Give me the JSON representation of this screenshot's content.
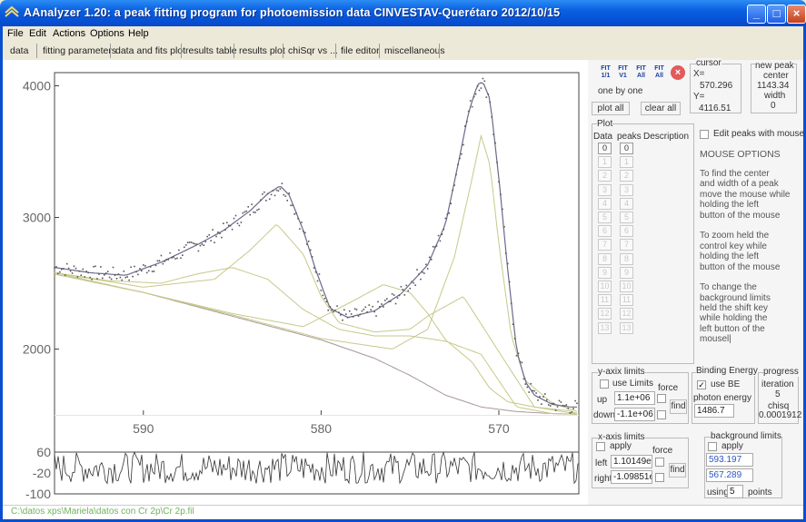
{
  "window": {
    "title": "AAnalyzer 1.20: a peak fitting program for photoemission data      CINVESTAV-Querétaro   2012/10/15",
    "close_icon": "×",
    "minimize_icon": "_",
    "maximize_icon": "□"
  },
  "menu": [
    "File",
    "Edit",
    "Actions",
    "Options",
    "Help"
  ],
  "tabs": [
    "data",
    "fitting parameters",
    "data and fits plot",
    "results table",
    "results plot",
    "chiSqr vs ...",
    "file editor",
    "miscellaneous"
  ],
  "toolbar": {
    "icons": [
      {
        "name": "fit-one-icon",
        "top": "FIT",
        "bottom": "1/1"
      },
      {
        "name": "fit-one-alt-icon",
        "top": "FIT",
        "bottom": "V1"
      },
      {
        "name": "fit-all-icon",
        "top": "FIT",
        "bottom": "All"
      },
      {
        "name": "fit-all-alt-icon",
        "top": "FIT",
        "bottom": "All"
      }
    ],
    "mode_label": "one by one",
    "plot_all": "plot all",
    "clear_all": "clear all"
  },
  "cursor": {
    "title": "cursor",
    "x_label": "X=",
    "x_value": "570.296",
    "y_label": "Y=",
    "y_value": "4116.51"
  },
  "new_peak": {
    "title": "new peak",
    "center_label": "center",
    "center_value": "1143.34",
    "width_label": "width",
    "width_value": "0"
  },
  "plot_panel": {
    "title": "Plot",
    "col_data": "Data",
    "col_peaks": "peaks",
    "col_desc": "Description",
    "data_items": [
      "0",
      "1",
      "2",
      "3",
      "4",
      "5",
      "6",
      "7",
      "8",
      "9",
      "10",
      "11",
      "12",
      "13"
    ],
    "peak_items": [
      "0",
      "1",
      "2",
      "3",
      "4",
      "5",
      "6",
      "7",
      "8",
      "9",
      "10",
      "11",
      "12",
      "13"
    ]
  },
  "edit_peaks": {
    "label": "Edit peaks with mouse"
  },
  "mouse_options": {
    "title": "MOUSE OPTIONS",
    "lines": [
      "To find the center",
      "and width of a peak",
      "move the mouse while",
      "holding the left",
      "button of the mouse",
      "",
      "To zoom held the",
      "control key while",
      "holding the left",
      "button of the mouse",
      "",
      "To change the",
      "background limits",
      "held the shift key",
      "while holding the",
      "left button of the",
      "mousel|"
    ]
  },
  "y_axis_limits": {
    "title": "y-axix limits",
    "use_limits": "use Limits",
    "force": "force",
    "up_label": "up",
    "up_value": "1.1e+06",
    "down_label": "down",
    "down_value": "-1.1e+06",
    "find": "find"
  },
  "binding_energy": {
    "title": "Binding Energy",
    "use_be": "use BE",
    "photon_label": "photon energy",
    "photon_value": "1486.7"
  },
  "progress": {
    "title": "progress",
    "iteration_label": "iteration",
    "iteration_value": "5",
    "chisq_label": "chisq",
    "chisq_value": "0.0001912"
  },
  "x_axis_limits": {
    "title": "x-axis limits",
    "apply": "apply",
    "force": "force",
    "left_label": "left",
    "left_value": "1.10149e",
    "right_label": "right",
    "right_value": "-1.09851e",
    "find": "find"
  },
  "background_limits": {
    "title": "background limits",
    "apply": "apply",
    "value1": "593.197",
    "value2": "567.289",
    "using_label": "using",
    "using_value": "5",
    "points_label": "points"
  },
  "status": "C:\\datos xps\\Mariela\\datos con Cr 2p\\Cr 2p.fil",
  "chart_data": [
    {
      "type": "line",
      "title": "",
      "xlabel": "Binding Energy",
      "ylabel": "",
      "xlim": [
        595,
        565.5
      ],
      "ylim": [
        1500,
        4100
      ],
      "x_ticks": [
        590,
        580,
        570
      ],
      "y_ticks": [
        2000,
        3000,
        4000
      ],
      "colors": {
        "data": "#555555",
        "fit": "#6a6a8a",
        "peaks": "#c8c88a",
        "background": "#a89898"
      },
      "series": [
        {
          "name": "background",
          "x": [
            595,
            590,
            585,
            580,
            577,
            575,
            573,
            571,
            569,
            567,
            565.5
          ],
          "values": [
            2570,
            2430,
            2250,
            2070,
            1930,
            1800,
            1650,
            1560,
            1525,
            1510,
            1505
          ]
        },
        {
          "name": "peak1",
          "x": [
            595,
            592,
            589,
            587,
            585,
            583,
            581,
            579,
            577,
            575,
            573,
            571,
            569,
            567,
            565.5
          ],
          "values": [
            2580,
            2520,
            2500,
            2570,
            2620,
            2530,
            2300,
            2150,
            2100,
            2100,
            2060,
            1960,
            1560,
            1510,
            1505
          ]
        },
        {
          "name": "peak2",
          "x": [
            595,
            590,
            586,
            584,
            582.5,
            581,
            580,
            579,
            577,
            575,
            574,
            572,
            570,
            568,
            565.5
          ],
          "values": [
            2580,
            2470,
            2530,
            2750,
            2950,
            2720,
            2400,
            2200,
            2130,
            2150,
            2250,
            2400,
            1980,
            1560,
            1505
          ]
        },
        {
          "name": "peak3",
          "x": [
            595,
            590,
            585,
            581,
            578,
            576.5,
            575,
            574,
            573,
            571.5,
            570.5,
            569.5,
            568,
            566,
            565.5
          ],
          "values": [
            2580,
            2430,
            2270,
            2170,
            2380,
            2490,
            2430,
            2270,
            2070,
            1900,
            1700,
            1600,
            1560,
            1530,
            1505
          ]
        },
        {
          "name": "peak4",
          "x": [
            595,
            590,
            585,
            580,
            576,
            574,
            572.5,
            571.5,
            571,
            570.5,
            570,
            569.3,
            568.5,
            567,
            565.5
          ],
          "values": [
            2570,
            2430,
            2260,
            2080,
            2000,
            2150,
            2700,
            3300,
            3620,
            3400,
            2800,
            2100,
            1760,
            1590,
            1520
          ]
        },
        {
          "name": "fit",
          "x": [
            595,
            593,
            591,
            589,
            587,
            585.5,
            584,
            583,
            582.3,
            581.8,
            581,
            580.3,
            579.5,
            578.5,
            577,
            575.5,
            574,
            573,
            572.3,
            571.7,
            571.2,
            570.9,
            570.5,
            570,
            569.5,
            569,
            568.5,
            568,
            567,
            566,
            565.5
          ],
          "values": [
            2620,
            2580,
            2560,
            2660,
            2790,
            2900,
            3050,
            3180,
            3240,
            3170,
            2900,
            2600,
            2310,
            2240,
            2290,
            2420,
            2640,
            2950,
            3400,
            3800,
            4010,
            4030,
            3900,
            3300,
            2600,
            1990,
            1750,
            1650,
            1580,
            1560,
            1560
          ]
        }
      ]
    },
    {
      "type": "line",
      "title": "",
      "xlabel": "",
      "ylabel": "",
      "ylim": [
        -100,
        60
      ],
      "y_ticks": [
        60,
        -20,
        -100
      ],
      "series": [
        {
          "name": "residuals",
          "values": []
        }
      ]
    }
  ]
}
